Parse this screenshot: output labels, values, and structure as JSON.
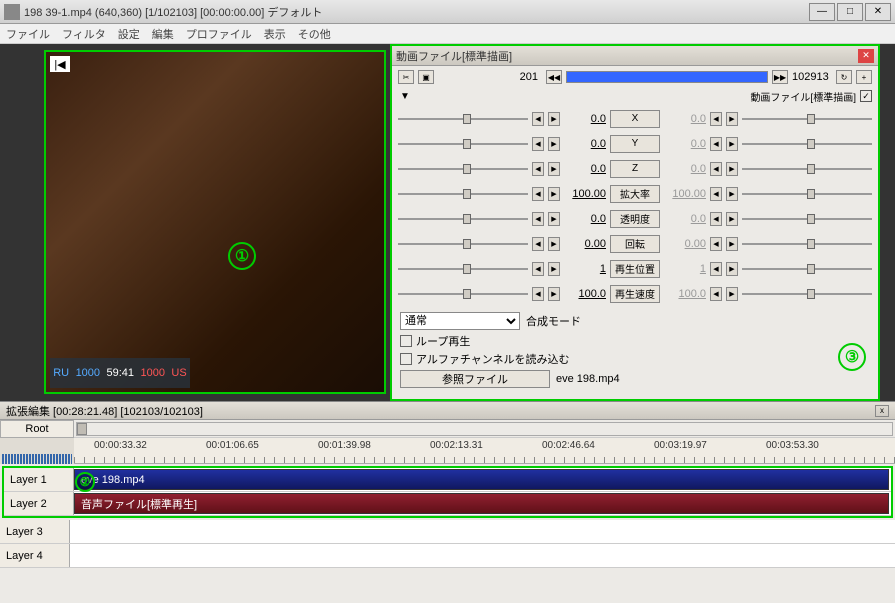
{
  "window": {
    "title": "198 39-1.mp4 (640,360)  [1/102103] [00:00:00.00]  デフォルト",
    "min": "—",
    "max": "□",
    "close": "✕"
  },
  "menu": {
    "file": "ファイル",
    "filter": "フィルタ",
    "settings": "設定",
    "edit": "編集",
    "profile": "プロファイル",
    "view": "表示",
    "other": "その他"
  },
  "preview": {
    "goto_start": "|◀",
    "marker1": "①",
    "hud_ru": "RU",
    "hud_ru_val": "1000",
    "hud_time": "59:41",
    "hud_us": "US",
    "hud_us_val": "1000"
  },
  "panel": {
    "title": "動画ファイル[標準描画]",
    "close": "✕",
    "top": {
      "icon1": "✂",
      "icon2": "▣",
      "frame_start": "201",
      "prev": "◀◀",
      "next": "▶▶",
      "frame_end": "102913",
      "loop": "↻",
      "add": "+"
    },
    "sub": {
      "arrow": "▼",
      "mouse": "✥",
      "label": "動画ファイル[標準描画]",
      "checked": "✓"
    },
    "rows": [
      {
        "v1": "0.0",
        "name": "X",
        "v2": "0.0"
      },
      {
        "v1": "0.0",
        "name": "Y",
        "v2": "0.0"
      },
      {
        "v1": "0.0",
        "name": "Z",
        "v2": "0.0"
      },
      {
        "v1": "100.00",
        "name": "拡大率",
        "v2": "100.00"
      },
      {
        "v1": "0.0",
        "name": "透明度",
        "v2": "0.0"
      },
      {
        "v1": "0.00",
        "name": "回転",
        "v2": "0.00"
      },
      {
        "v1": "1",
        "name": "再生位置",
        "v2": "1"
      },
      {
        "v1": "100.0",
        "name": "再生速度",
        "v2": "100.0"
      }
    ],
    "step_left": "◀",
    "step_right": "▶",
    "blend": {
      "value": "通常",
      "label": "合成モード"
    },
    "loop_playback": "ループ再生",
    "alpha": "アルファチャンネルを読み込む",
    "ref_button": "参照ファイル",
    "ref_file": "eve 198.mp4",
    "marker3": "③"
  },
  "timeline": {
    "title": "拡張編集 [00:28:21.48] [102103/102103]",
    "close": "x",
    "root": "Root",
    "ticks": [
      "00:00:33.32",
      "00:01:06.65",
      "00:01:39.98",
      "00:02:13.31",
      "00:02:46.64",
      "00:03:19.97",
      "00:03:53.30"
    ],
    "layers": [
      {
        "name": "Layer 1",
        "clip": "eve 198.mp4",
        "type": "video"
      },
      {
        "name": "Layer 2",
        "clip": "音声ファイル[標準再生]",
        "type": "audio"
      },
      {
        "name": "Layer 3",
        "clip": "",
        "type": ""
      },
      {
        "name": "Layer 4",
        "clip": "",
        "type": ""
      }
    ],
    "marker2": "②"
  }
}
